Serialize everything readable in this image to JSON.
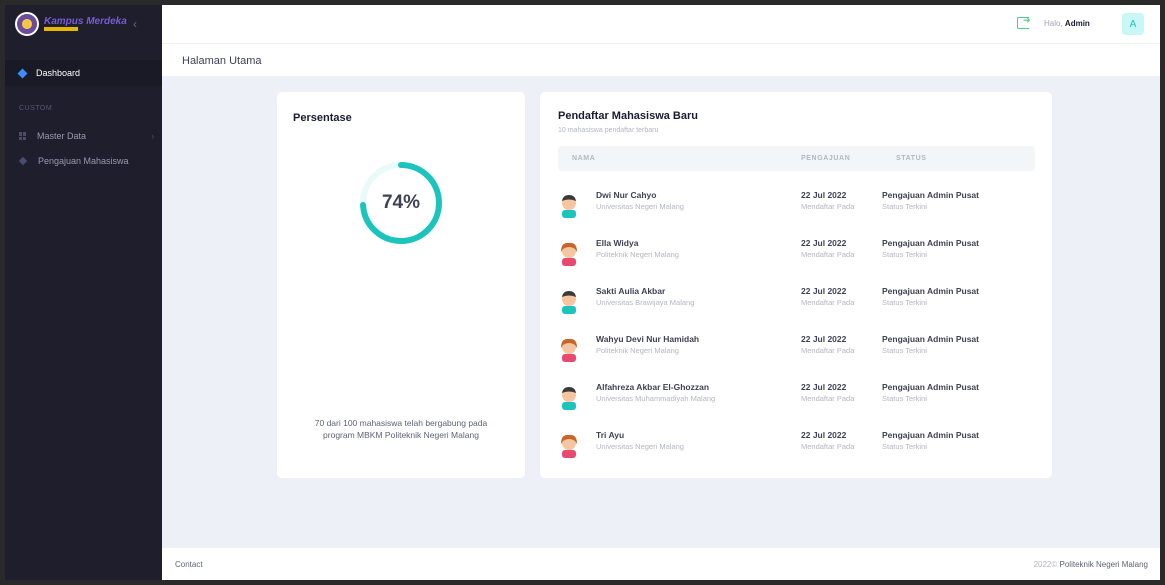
{
  "header": {
    "greeting": "Halo,",
    "user_name": "Admin",
    "avatar_letter": "A"
  },
  "sidebar": {
    "logo_text": "Kampus Merdeka",
    "active_item": "Dashboard",
    "section_caption": "CUSTOM",
    "items": [
      {
        "label": "Master Data",
        "icon": "grid-icon",
        "has_submenu": true
      },
      {
        "label": "Pengajuan Mahasiswa",
        "icon": "diamond-icon",
        "has_submenu": false
      }
    ]
  },
  "page": {
    "title": "Halaman Utama"
  },
  "percent_card": {
    "title": "Persentase",
    "value_label": "74%",
    "progress": 0.74,
    "caption_line1": "70 dari 100 mahasiswa telah bergabung pada",
    "caption_line2": "program MBKM Politeknik Negeri Malang"
  },
  "applicants_card": {
    "title": "Pendaftar Mahasiswa Baru",
    "subtitle": "10 mahasiswa pendaftar terbaru",
    "columns": [
      "NAMA",
      "PENGAJUAN",
      "STATUS"
    ],
    "rows": [
      {
        "name": "Dwi Nur Cahyo",
        "university": "Universitas Negeri Malang",
        "date": "22 Jul 2022",
        "date_label": "Mendaftar Pada",
        "status": "Pengajuan Admin Pusat",
        "status_label": "Status Terkini",
        "avatar": "male"
      },
      {
        "name": "Ella Widya",
        "university": "Politeknik Negeri Malang",
        "date": "22 Jul 2022",
        "date_label": "Mendaftar Pada",
        "status": "Pengajuan Admin Pusat",
        "status_label": "Status Terkini",
        "avatar": "female"
      },
      {
        "name": "Sakti Aulia Akbar",
        "university": "Universitas Brawijaya Malang",
        "date": "22 Jul 2022",
        "date_label": "Mendaftar Pada",
        "status": "Pengajuan Admin Pusat",
        "status_label": "Status Terkini",
        "avatar": "male"
      },
      {
        "name": "Wahyu Devi Nur Hamidah",
        "university": "Politeknik Negeri Malang",
        "date": "22 Jul 2022",
        "date_label": "Mendaftar Pada",
        "status": "Pengajuan Admin Pusat",
        "status_label": "Status Terkini",
        "avatar": "female"
      },
      {
        "name": "Alfahreza Akbar El-Ghozzan",
        "university": "Universitas Muhammadiyah Malang",
        "date": "22 Jul 2022",
        "date_label": "Mendaftar Pada",
        "status": "Pengajuan Admin Pusat",
        "status_label": "Status Terkini",
        "avatar": "male"
      },
      {
        "name": "Tri Ayu",
        "university": "Universitas Negeri Malang",
        "date": "22 Jul 2022",
        "date_label": "Mendaftar Pada",
        "status": "Pengajuan Admin Pusat",
        "status_label": "Status Terkini",
        "avatar": "female"
      }
    ]
  },
  "footer": {
    "contact": "Contact",
    "year": "2022©",
    "org": "Politeknik Negeri Malang"
  },
  "colors": {
    "accent": "#1bc5bd",
    "sidebar_bg": "#1e1e2d",
    "active_dot": "#3f8cff"
  }
}
